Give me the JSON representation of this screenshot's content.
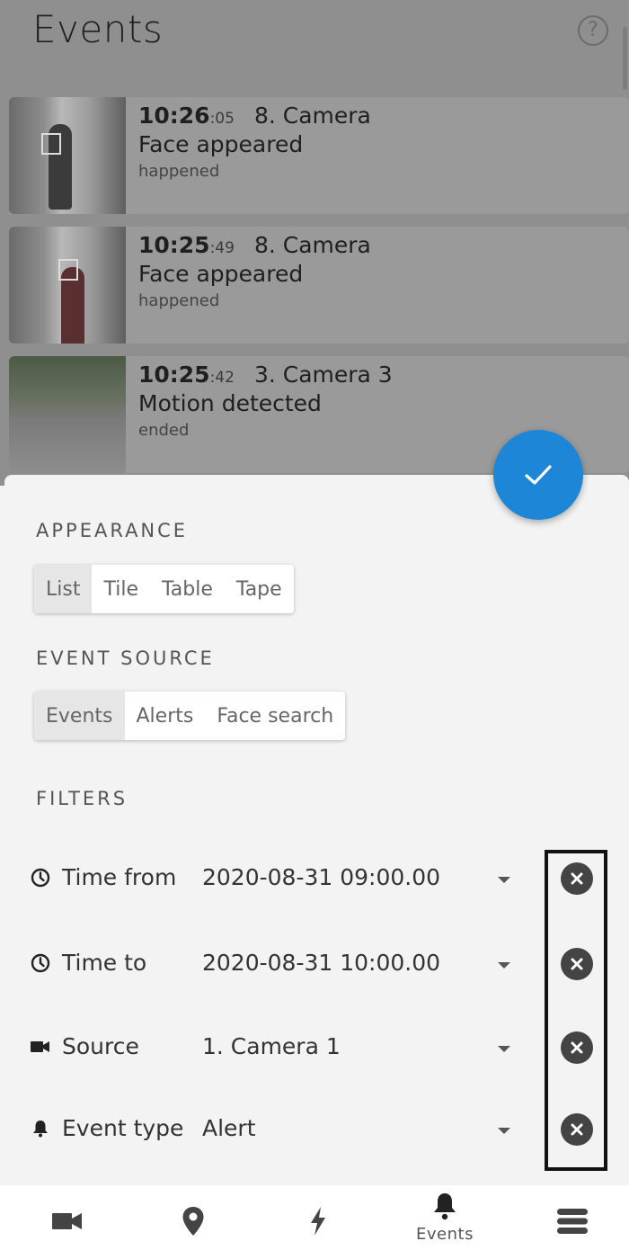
{
  "header": {
    "title": "Events",
    "help_icon": "help-circle-icon"
  },
  "events": [
    {
      "time_hm": "10:26",
      "time_s": ":05",
      "camera": "8. Camera",
      "type": "Face appeared",
      "state": "happened"
    },
    {
      "time_hm": "10:25",
      "time_s": ":49",
      "camera": "8. Camera",
      "type": "Face appeared",
      "state": "happened"
    },
    {
      "time_hm": "10:25",
      "time_s": ":42",
      "camera": "3. Camera 3",
      "type": "Motion detected",
      "state": "ended"
    }
  ],
  "sheet": {
    "confirm_icon": "check-icon",
    "appearance": {
      "heading": "APPEARANCE",
      "options": [
        "List",
        "Tile",
        "Table",
        "Tape"
      ],
      "selected": "List"
    },
    "event_source": {
      "heading": "EVENT SOURCE",
      "options": [
        "Events",
        "Alerts",
        "Face search"
      ],
      "selected": "Events"
    },
    "filters": {
      "heading": "FILTERS",
      "rows": [
        {
          "label": "Time from",
          "value": "2020-08-31 09:00.00",
          "icon": "clock-icon"
        },
        {
          "label": "Time to",
          "value": "2020-08-31 10:00.00",
          "icon": "clock-icon"
        },
        {
          "label": "Source",
          "value": "1. Camera 1",
          "icon": "video-camera-icon"
        },
        {
          "label": "Event type",
          "value": "Alert",
          "icon": "bell-icon"
        }
      ]
    }
  },
  "nav": {
    "items": [
      {
        "icon": "video-camera-icon",
        "label": ""
      },
      {
        "icon": "map-pin-icon",
        "label": ""
      },
      {
        "icon": "lightning-icon",
        "label": ""
      },
      {
        "icon": "bell-icon",
        "label": "Events"
      },
      {
        "icon": "server-stack-icon",
        "label": ""
      }
    ],
    "active": "Events"
  },
  "colors": {
    "accent": "#1e86d6",
    "overlay": "#8f8f8f",
    "sheet": "#f3f3f3",
    "clear_button": "#444444"
  }
}
